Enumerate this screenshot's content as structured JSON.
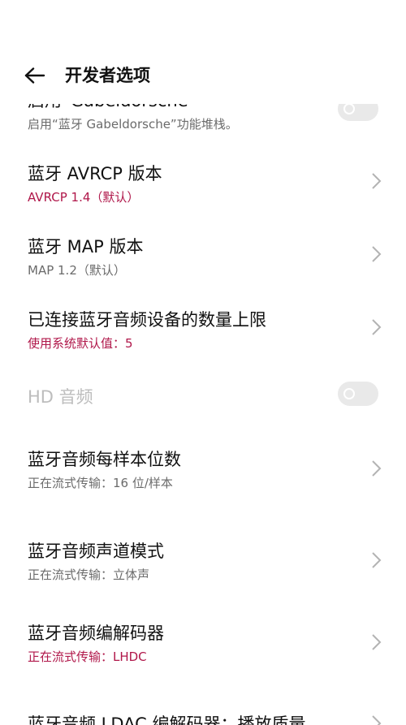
{
  "header": {
    "title": "开发者选项"
  },
  "rows": [
    {
      "title": "启用“Gabeldorsche”",
      "subtitle": "启用“蓝牙 Gabeldorsche”功能堆栈。"
    },
    {
      "title": "蓝牙 AVRCP 版本",
      "subtitle": "AVRCP 1.4（默认）"
    },
    {
      "title": "蓝牙 MAP 版本",
      "subtitle": "MAP 1.2（默认）"
    },
    {
      "title": "已连接蓝牙音频设备的数量上限",
      "subtitle": "使用系统默认值：5"
    },
    {
      "title": "HD 音频"
    },
    {
      "title": "蓝牙音频每样本位数",
      "subtitle": "正在流式传输：16 位/样本"
    },
    {
      "title": "蓝牙音频声道模式",
      "subtitle": "正在流式传输：立体声"
    },
    {
      "title": "蓝牙音频编解码器",
      "subtitle": "正在流式传输：LHDC"
    },
    {
      "title": "蓝牙音频 LDAC 编解码器：播放质量"
    }
  ],
  "colors": {
    "accent": "#b0174a",
    "subtitle": "#6b6b6b",
    "disabled": "#bdbdbd",
    "toggle_off": "#e9e9e9",
    "chevron": "#b3b3b3"
  },
  "icons": {
    "back": "arrow-left-icon",
    "chevron": "chevron-right-icon"
  }
}
